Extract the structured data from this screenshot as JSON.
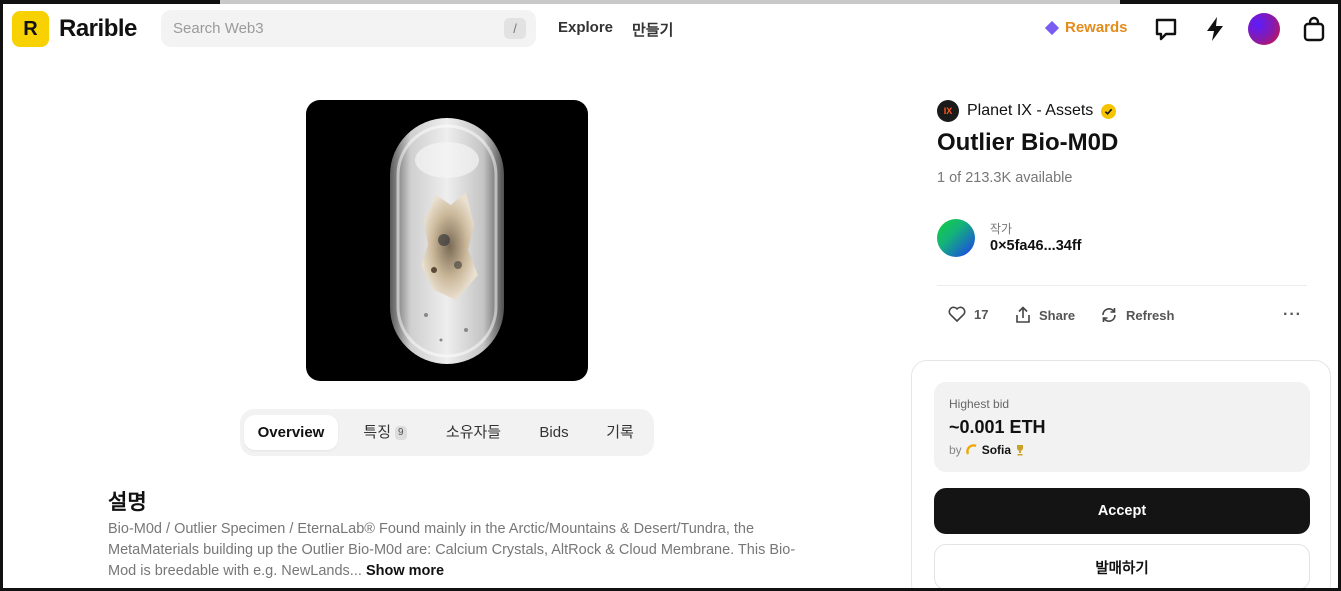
{
  "header": {
    "logo_letter": "R",
    "brand": "Rarible",
    "search": {
      "placeholder": "Search Web3",
      "shortcut": "/"
    },
    "nav": {
      "explore": "Explore",
      "create": "만들기"
    },
    "rewards": "Rewards",
    "icons": [
      "chat-icon",
      "lightning-icon",
      "avatar",
      "bag-icon"
    ]
  },
  "artwork": {
    "icon": "capsule-artwork"
  },
  "tabs": [
    {
      "label": "Overview",
      "active": true
    },
    {
      "label": "특징",
      "count": "9"
    },
    {
      "label": "소유자들"
    },
    {
      "label": "Bids"
    },
    {
      "label": "기록"
    }
  ],
  "description": {
    "title": "설명",
    "body": "Bio-M0d / Outlier Specimen / EternaLab® Found mainly in the Arctic/Mountains & Desert/Tundra, the MetaMaterials building up the Outlier Bio-M0d are: Calcium Crystals, AltRock & Cloud Membrane. This Bio-Mod is breedable with e.g. NewLands...",
    "show_more": "Show more"
  },
  "item": {
    "collection_logo": "IX",
    "collection": "Planet IX - Assets",
    "title": "Outlier Bio-M0D",
    "available": "1 of 213.3K available",
    "creator_label": "작가",
    "creator_address": "0×5fa46...34ff"
  },
  "actions": {
    "likes": "17",
    "share": "Share",
    "refresh": "Refresh",
    "more": "···"
  },
  "bid": {
    "label": "Highest bid",
    "value": "~0.001 ETH",
    "by_prefix": "by",
    "bidder": "Sofia"
  },
  "buttons": {
    "accept": "Accept",
    "sell": "발매하기"
  },
  "colors": {
    "logo": "#f7d100",
    "rewards": "#e38c1c",
    "accept_bg": "#141414"
  }
}
